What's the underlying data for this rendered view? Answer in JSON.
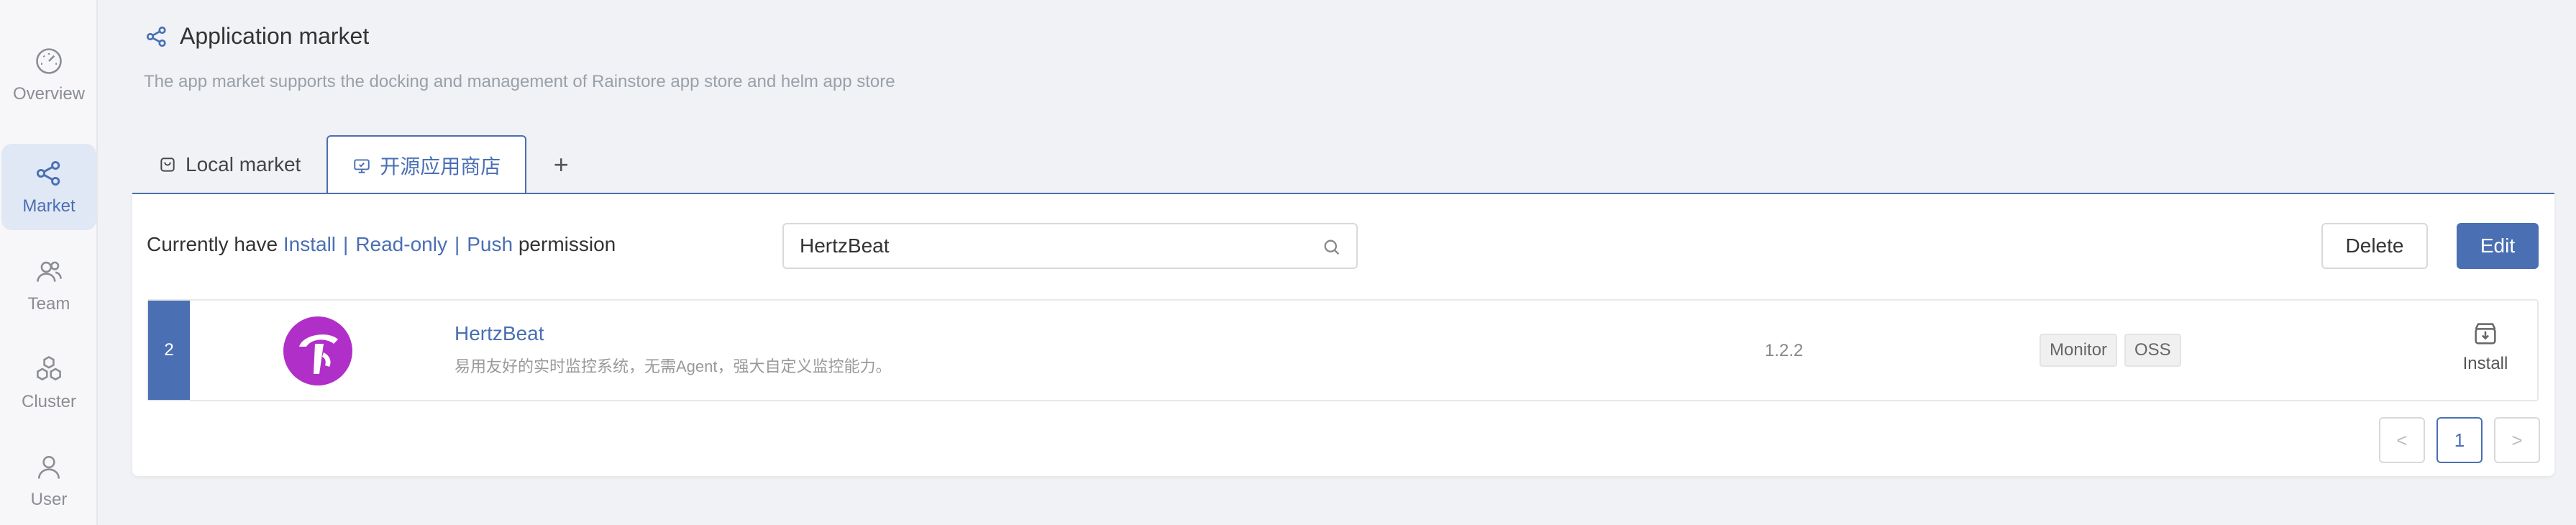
{
  "sidebar": {
    "items": [
      {
        "label": "Overview",
        "icon": "gauge-icon"
      },
      {
        "label": "Market",
        "icon": "share-icon"
      },
      {
        "label": "Team",
        "icon": "team-icon"
      },
      {
        "label": "Cluster",
        "icon": "cluster-icon"
      },
      {
        "label": "User",
        "icon": "user-icon"
      }
    ],
    "active": "Market"
  },
  "header": {
    "title": "Application market",
    "description": "The app market supports the docking and management of Rainstore app store and helm app store"
  },
  "tabs": [
    {
      "label": "Local market"
    },
    {
      "label": "开源应用商店"
    }
  ],
  "add_tab_label": "+",
  "permission": {
    "prefix": "Currently have",
    "install": "Install",
    "read_only": "Read-only",
    "push": "Push",
    "suffix": "permission",
    "separator": "|"
  },
  "search": {
    "value": "HertzBeat",
    "placeholder": ""
  },
  "actions": {
    "delete": "Delete",
    "edit": "Edit"
  },
  "apps": [
    {
      "index": "2",
      "name": "HertzBeat",
      "description": "易用友好的实时监控系统，无需Agent，强大自定义监控能力。",
      "version": "1.2.2",
      "tags": [
        "Monitor",
        "OSS"
      ],
      "install_label": "Install"
    }
  ],
  "pagination": {
    "prev": "<",
    "current": "1",
    "next": ">"
  },
  "colors": {
    "accent": "#4a6fb3",
    "logo": "#b02fc8"
  }
}
